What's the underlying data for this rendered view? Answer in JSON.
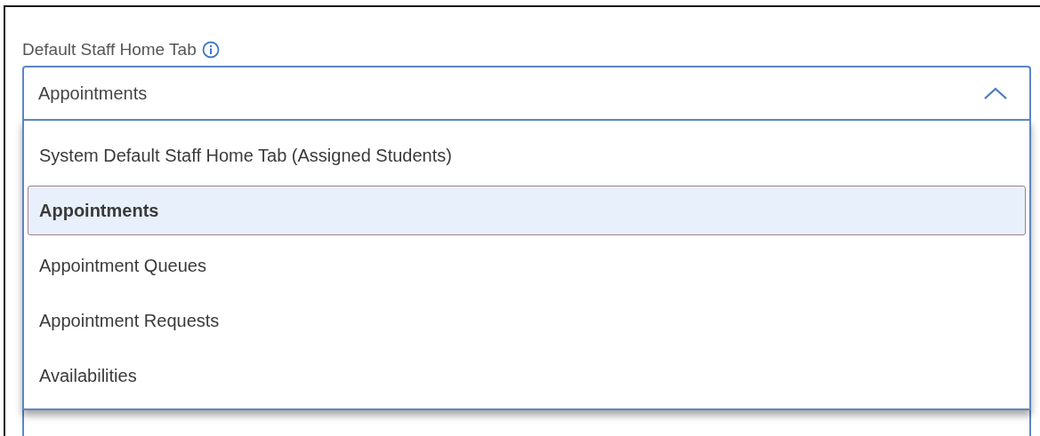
{
  "field": {
    "label": "Default Staff Home Tab",
    "value": "Appointments",
    "expanded": true
  },
  "options": [
    {
      "label": "System Default Staff Home Tab (Assigned Students)",
      "selected": false
    },
    {
      "label": "Appointments",
      "selected": true
    },
    {
      "label": "Appointment Queues",
      "selected": false
    },
    {
      "label": "Appointment Requests",
      "selected": false
    },
    {
      "label": "Availabilities",
      "selected": false
    }
  ]
}
